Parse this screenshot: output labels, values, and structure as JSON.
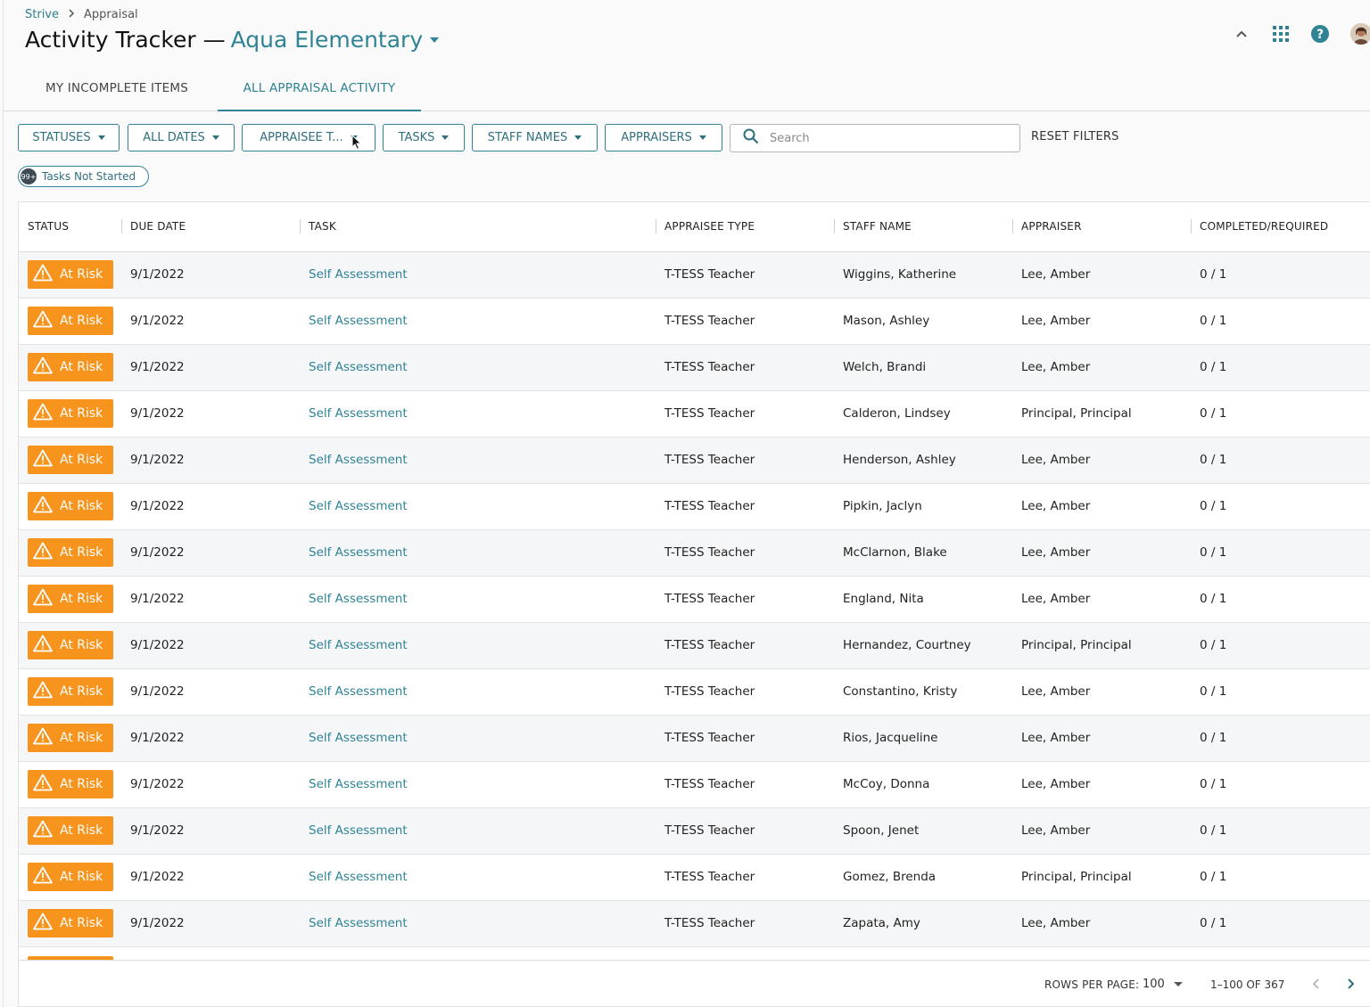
{
  "breadcrumb": {
    "root": "Strive",
    "current": "Appraisal"
  },
  "header": {
    "title": "Activity Tracker —",
    "school": "Aqua Elementary"
  },
  "tabs": [
    {
      "label": "MY INCOMPLETE ITEMS",
      "active": false
    },
    {
      "label": "ALL APPRAISAL ACTIVITY",
      "active": true
    }
  ],
  "filters": {
    "statuses": "STATUSES",
    "dates": "ALL DATES",
    "appraisee_type": "APPRAISEE T...",
    "tasks": "TASKS",
    "staff_names": "STAFF NAMES",
    "appraisers": "APPRAISERS",
    "search_placeholder": "Search",
    "reset": "RESET FILTERS"
  },
  "chip": {
    "badge": "99+",
    "label": "Tasks Not Started"
  },
  "columns": {
    "status": "STATUS",
    "due_date": "DUE DATE",
    "task": "TASK",
    "appraisee_type": "APPRAISEE TYPE",
    "staff_name": "STAFF NAME",
    "appraiser": "APPRAISER",
    "completed": "COMPLETED/REQUIRED"
  },
  "rows": [
    {
      "status": "At Risk",
      "due": "9/1/2022",
      "task": "Self Assessment",
      "type": "T-TESS Teacher",
      "staff": "Wiggins, Katherine",
      "appraiser": "Lee, Amber",
      "completed": "0 / 1"
    },
    {
      "status": "At Risk",
      "due": "9/1/2022",
      "task": "Self Assessment",
      "type": "T-TESS Teacher",
      "staff": "Mason, Ashley",
      "appraiser": "Lee, Amber",
      "completed": "0 / 1"
    },
    {
      "status": "At Risk",
      "due": "9/1/2022",
      "task": "Self Assessment",
      "type": "T-TESS Teacher",
      "staff": "Welch, Brandi",
      "appraiser": "Lee, Amber",
      "completed": "0 / 1"
    },
    {
      "status": "At Risk",
      "due": "9/1/2022",
      "task": "Self Assessment",
      "type": "T-TESS Teacher",
      "staff": "Calderon, Lindsey",
      "appraiser": "Principal, Principal",
      "completed": "0 / 1"
    },
    {
      "status": "At Risk",
      "due": "9/1/2022",
      "task": "Self Assessment",
      "type": "T-TESS Teacher",
      "staff": "Henderson, Ashley",
      "appraiser": "Lee, Amber",
      "completed": "0 / 1"
    },
    {
      "status": "At Risk",
      "due": "9/1/2022",
      "task": "Self Assessment",
      "type": "T-TESS Teacher",
      "staff": "Pipkin, Jaclyn",
      "appraiser": "Lee, Amber",
      "completed": "0 / 1"
    },
    {
      "status": "At Risk",
      "due": "9/1/2022",
      "task": "Self Assessment",
      "type": "T-TESS Teacher",
      "staff": "McClarnon, Blake",
      "appraiser": "Lee, Amber",
      "completed": "0 / 1"
    },
    {
      "status": "At Risk",
      "due": "9/1/2022",
      "task": "Self Assessment",
      "type": "T-TESS Teacher",
      "staff": "England, Nita",
      "appraiser": "Lee, Amber",
      "completed": "0 / 1"
    },
    {
      "status": "At Risk",
      "due": "9/1/2022",
      "task": "Self Assessment",
      "type": "T-TESS Teacher",
      "staff": "Hernandez, Courtney",
      "appraiser": "Principal, Principal",
      "completed": "0 / 1"
    },
    {
      "status": "At Risk",
      "due": "9/1/2022",
      "task": "Self Assessment",
      "type": "T-TESS Teacher",
      "staff": "Constantino, Kristy",
      "appraiser": "Lee, Amber",
      "completed": "0 / 1"
    },
    {
      "status": "At Risk",
      "due": "9/1/2022",
      "task": "Self Assessment",
      "type": "T-TESS Teacher",
      "staff": "Rios, Jacqueline",
      "appraiser": "Lee, Amber",
      "completed": "0 / 1"
    },
    {
      "status": "At Risk",
      "due": "9/1/2022",
      "task": "Self Assessment",
      "type": "T-TESS Teacher",
      "staff": "McCoy, Donna",
      "appraiser": "Lee, Amber",
      "completed": "0 / 1"
    },
    {
      "status": "At Risk",
      "due": "9/1/2022",
      "task": "Self Assessment",
      "type": "T-TESS Teacher",
      "staff": "Spoon, Jenet",
      "appraiser": "Lee, Amber",
      "completed": "0 / 1"
    },
    {
      "status": "At Risk",
      "due": "9/1/2022",
      "task": "Self Assessment",
      "type": "T-TESS Teacher",
      "staff": "Gomez, Brenda",
      "appraiser": "Principal, Principal",
      "completed": "0 / 1"
    },
    {
      "status": "At Risk",
      "due": "9/1/2022",
      "task": "Self Assessment",
      "type": "T-TESS Teacher",
      "staff": "Zapata, Amy",
      "appraiser": "Lee, Amber",
      "completed": "0 / 1"
    }
  ],
  "pagination": {
    "rows_label": "ROWS PER PAGE:",
    "rows_value": "100",
    "range": "1–100 OF 367"
  },
  "colors": {
    "accent": "#2f8394",
    "at_risk": "#f7941d"
  }
}
